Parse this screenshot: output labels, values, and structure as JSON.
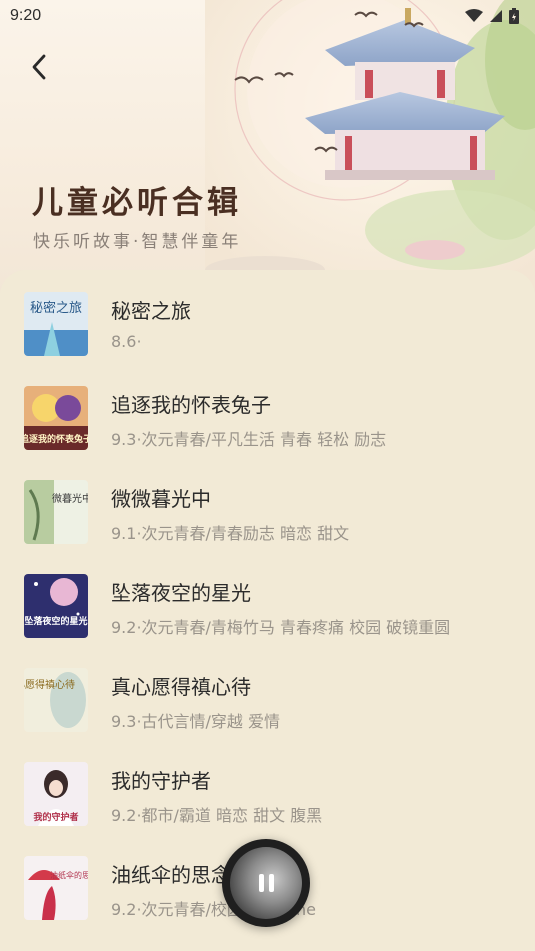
{
  "status_bar": {
    "time": "9:20"
  },
  "header": {
    "title": "儿童必听合辑",
    "subtitle": "快乐听故事·智慧伴童年"
  },
  "books": [
    {
      "title": "秘密之旅",
      "meta": "8.6·",
      "cover_text": "秘密之旅",
      "cover_color": "#5b9bd0"
    },
    {
      "title": "追逐我的怀表兔子",
      "meta": "9.3·次元青春/平凡生活 青春 轻松 励志",
      "cover_text": "追逐我的怀表兔子",
      "cover_color": "#c26a3a"
    },
    {
      "title": "微微暮光中",
      "meta": "9.1·次元青春/青春励志 暗恋 甜文",
      "cover_text": "微暮光中",
      "cover_color": "#9fb98d"
    },
    {
      "title": "坠落夜空的星光",
      "meta": "9.2·次元青春/青梅竹马 青春疼痛 校园 破镜重圆",
      "cover_text": "坠落夜空的星光",
      "cover_color": "#3d3c7a"
    },
    {
      "title": "真心愿得禛心待",
      "meta": "9.3·古代言情/穿越 爱情",
      "cover_text": "真心愿得禛心待",
      "cover_color": "#d8d3b4"
    },
    {
      "title": "我的守护者",
      "meta": "9.2·都市/霸道 暗恋 甜文 腹黑",
      "cover_text": "我的守护者",
      "cover_color": "#e7d7e0"
    },
    {
      "title": "油纸伞的思念",
      "meta": "9.2·次元青春/校园  虐恋，he",
      "cover_text": "油纸伞的思念",
      "cover_color": "#e9e2e4"
    }
  ],
  "player": {
    "state": "playing"
  },
  "colors": {
    "background": "#f2ead6",
    "title": "#4a2f22",
    "meta": "#9a948b"
  }
}
